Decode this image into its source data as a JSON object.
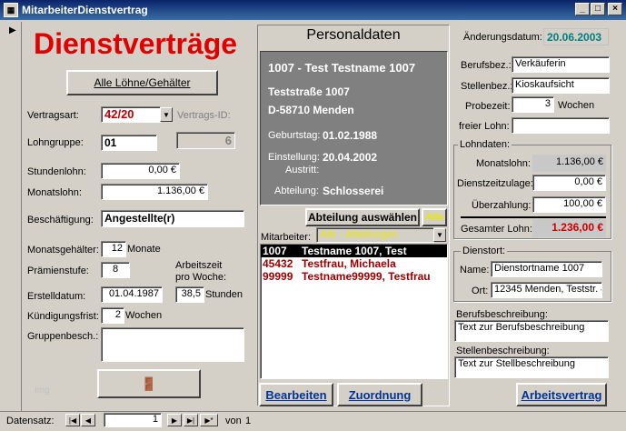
{
  "window": {
    "title": "MitarbeiterDienstvertrag",
    "minimize": "_",
    "maximize": "□",
    "close": "×"
  },
  "left": {
    "heading": "Dienstverträge",
    "alle_button": "Alle Löhne/Gehälter",
    "vertragsart_label": "Vertragsart:",
    "vertragsart_value": "42/20",
    "vertrags_id_label": "Vertrags-ID:",
    "lohngruppe_label": "Lohngruppe:",
    "lohngruppe_value": "01",
    "id_value": "6",
    "stundenlohn_label": "Stundenlohn:",
    "stundenlohn_value": "0,00 €",
    "monatslohn_label": "Monatslohn:",
    "monatslohn_value": "1.136,00 €",
    "beschaeftigung_label": "Beschäftigung:",
    "beschaeftigung_value": "Angestellte(r)",
    "monatsgehaelter_label": "Monatsgehälter:",
    "monatsgehaelter_value": "12",
    "monate_label": "Monate",
    "praemienstufe_label": "Prämienstufe:",
    "praemienstufe_value": "8",
    "arbeitszeit_label1": "Arbeitszeit",
    "arbeitszeit_label2": "pro Woche:",
    "erstelldatum_label": "Erstelldatum:",
    "erstelldatum_value": "01.04.1987",
    "stunden_value": "38,5",
    "stunden_label": "Stunden",
    "kuendigung_label": "Kündigungsfrist:",
    "kuendigung_value": "2",
    "wochen_label": "Wochen",
    "gruppenbesch_label": "Gruppenbesch.:",
    "gruppenbesch_value": "",
    "faint_label": "Img"
  },
  "center": {
    "title": "Personaldaten",
    "name_line": "1007 - Test Testname 1007",
    "street": "Teststraße 1007",
    "city": "D-58710 Menden",
    "geburtstag_label": "Geburtstag:",
    "geburtstag_value": "01.02.1988",
    "einstellung_label": "Einstellung:",
    "einstellung_value": "20.04.2002",
    "austritt_label": "Austritt:",
    "abteilung_label": "Abteilung:",
    "abteilung_value": "Schlosserei",
    "abteilung_btn": "Abteilung auswählen",
    "alle_btn": "Alle",
    "mitarbeiter_label": "Mitarbeiter:",
    "mitarbeiter_combo": "Alle - Abteilungen",
    "list": [
      {
        "id": "1007",
        "name": "Testname 1007, Test"
      },
      {
        "id": "45432",
        "name": "Testfrau, Michaela"
      },
      {
        "id": "99999",
        "name": "Testname99999, Testfrau"
      }
    ],
    "bearbeiten": "Bearbeiten",
    "zuordnung": "Zuordnung"
  },
  "right": {
    "aenderung_label": "Änderungsdatum:",
    "aenderung_value": "20.06.2003",
    "berufsbez_label": "Berufsbez.:",
    "berufsbez_value": "Verkäuferin",
    "stellenbez_label": "Stellenbez.:",
    "stellenbez_value": "Kioskaufsicht",
    "probezeit_label": "Probezeit:",
    "probezeit_value": "3",
    "probezeit_unit": "Wochen",
    "freier_lohn_label": "freier Lohn:",
    "freier_lohn_value": "",
    "lohndaten_title": "Lohndaten:",
    "monatslohn_label": "Monatslohn:",
    "monatslohn_value": "1.136,00 €",
    "dienstzeit_label": "Dienstzeitzulage:",
    "dienstzeit_value": "0,00 €",
    "ueberzahlung_label": "Überzahlung:",
    "ueberzahlung_value": "100,00 €",
    "gesamt_label": "Gesamter Lohn:",
    "gesamt_value": "1.236,00 €",
    "dienstort_title": "Dienstort:",
    "name_label": "Name:",
    "name_value": "Dienstortname 1007",
    "ort_label": "Ort:",
    "ort_value": "12345 Menden, Teststr. 4",
    "berufsbeschreibung_label": "Berufsbeschreibung:",
    "berufsbeschreibung_value": "Text zur Berufsbeschreibung",
    "stellenbeschreibung_label": "Stellenbeschreibung:",
    "stellenbeschreibung_value": "Text zur Stellbeschreibung",
    "arbeitsvertrag": "Arbeitsvertrag"
  },
  "nav": {
    "label": "Datensatz:",
    "current": "1",
    "of_label": "von",
    "total": "1"
  }
}
